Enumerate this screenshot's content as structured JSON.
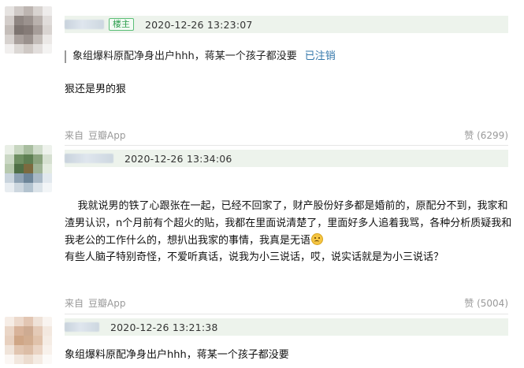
{
  "comments": [
    {
      "op_badge": "楼主",
      "time": "2020-12-26 13:23:07",
      "quote": {
        "text": "象组爆料原配净身出户hhh，蒋某一个孩子都没要",
        "status": "已注销"
      },
      "text": "狠还是男的狠",
      "source_prefix": "来自",
      "source_app": "豆瓣App",
      "likes": "赞 (6299)",
      "avatar_colors": [
        "#e6e3e1",
        "#cfc9c6",
        "#bdb5b1",
        "#d8d3d0",
        "#eeeceb",
        "#d3cdca",
        "#8f8682",
        "#9b928e",
        "#b9b1ad",
        "#e0dcda",
        "#c4bdb9",
        "#7d7470",
        "#857b77",
        "#a69d99",
        "#d9d4d1",
        "#d7d2cf",
        "#a9a09c",
        "#9a918d",
        "#c3bcb8",
        "#ebe8e6",
        "#f1efee",
        "#dcd8d5",
        "#cfc9c5",
        "#e2dedc",
        "#f4f3f2"
      ]
    },
    {
      "time": "2020-12-26 13:34:06",
      "text_part1": "我就说男的铁了心跟张在一起，已经不回家了，财产股份好多都是婚前的，原配分不到，我家和渣男认识，n个月前有个超火的贴，我都在里面说清楚了，里面好多人追着我骂，各种分析质疑我和我老公的工作什么的，想扒出我家的事情，我真是无语",
      "emoji": "sad-face",
      "text_part2": "有些人脑子特别奇怪，不爱听真话，说我为小三说话，哎，说实话就是为小三说话？",
      "source_prefix": "来自",
      "source_app": "豆瓣App",
      "likes": "赞 (5004)",
      "avatar_colors": [
        "#e9efe6",
        "#c7d6c0",
        "#a8bd9f",
        "#d0dccb",
        "#eef2ec",
        "#cbd8c5",
        "#6f8f63",
        "#5e7f53",
        "#8aa37e",
        "#d6e0d1",
        "#b7c9ae",
        "#4f6f46",
        "#7c6a3f",
        "#9fb396",
        "#e3ebdf",
        "#c9d4dd",
        "#8ea2b3",
        "#6d8598",
        "#a9b9c6",
        "#e1e8ee",
        "#e8edf1",
        "#cdd7df",
        "#b3c3cf",
        "#dbe3e9",
        "#f2f5f7"
      ]
    },
    {
      "time": "2020-12-26 13:21:38",
      "text": "象组爆料原配净身出户hhh，蒋某一个孩子都没要",
      "avatar_colors": [
        "#f6ede6",
        "#ecd9cc",
        "#e2c6b3",
        "#efe2d8",
        "#f9f4f0",
        "#ead6c7",
        "#d8b39a",
        "#ceab92",
        "#e4cab7",
        "#f3e8df",
        "#e7d0bf",
        "#cfa686",
        "#d2ad90",
        "#e0c2ab",
        "#f5ece4",
        "#f0e4da",
        "#e1c5b0",
        "#dcbda6",
        "#ead4c4",
        "#f8f1eb",
        "#fbf7f4",
        "#f2e7de",
        "#ecdccf",
        "#f4ebe3",
        "#fcfaf8"
      ]
    }
  ]
}
